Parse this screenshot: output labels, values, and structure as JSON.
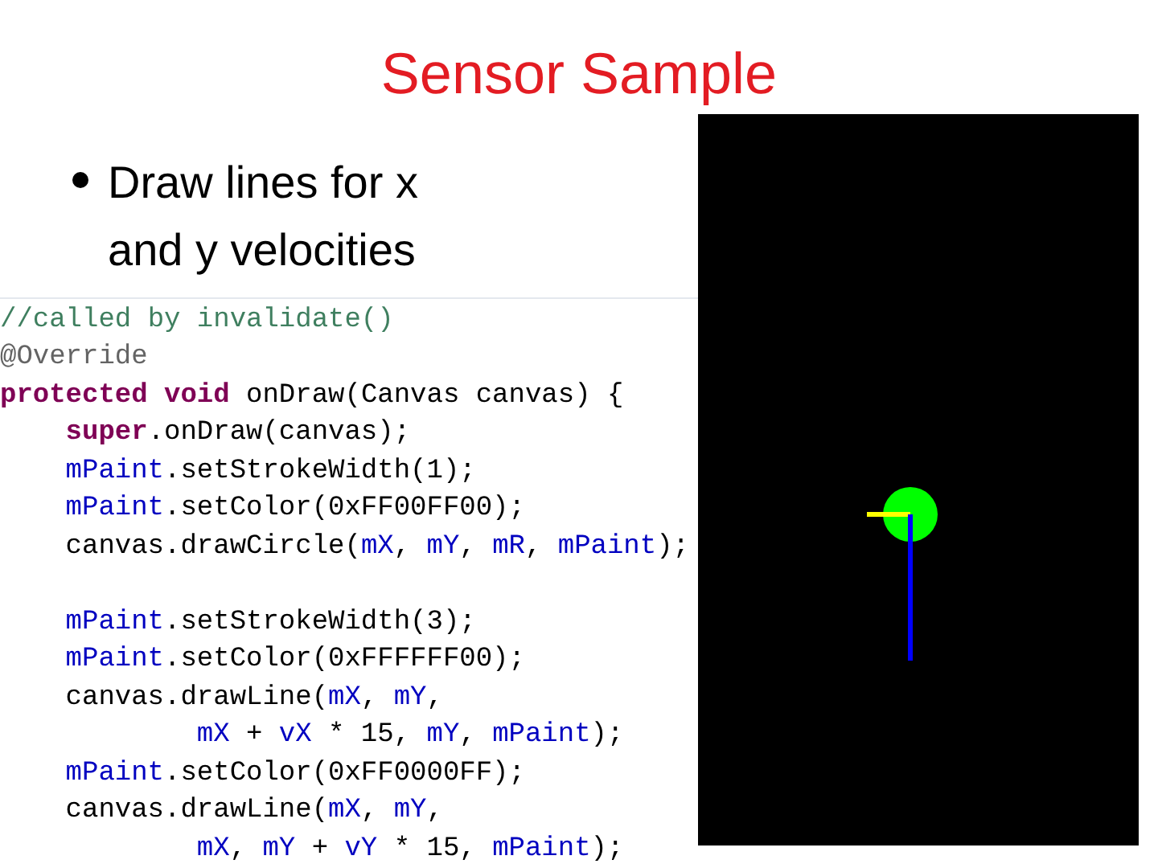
{
  "title": "Sensor Sample",
  "bullets": [
    "Draw lines for x and y velocities"
  ],
  "code": [
    {
      "tokens": [
        {
          "kind": "comment",
          "text": "//called by invalidate()"
        }
      ]
    },
    {
      "tokens": [
        {
          "kind": "annotation",
          "text": "@Override"
        }
      ]
    },
    {
      "tokens": [
        {
          "kind": "keyword",
          "text": "protected void"
        },
        {
          "kind": "plain",
          "text": " onDraw(Canvas canvas) {"
        }
      ],
      "blocks": [
        {
          "lines": [
            {
              "tokens": [
                {
                  "kind": "keyword",
                  "text": "super"
                },
                {
                  "kind": "plain",
                  "text": ".onDraw(canvas);"
                }
              ]
            },
            {
              "tokens": [
                {
                  "kind": "field",
                  "text": "mPaint"
                },
                {
                  "kind": "plain",
                  "text": ".setStrokeWidth(1);"
                }
              ]
            },
            {
              "tokens": [
                {
                  "kind": "field",
                  "text": "mPaint"
                },
                {
                  "kind": "plain",
                  "text": ".setColor(0xFF00FF00);"
                }
              ]
            },
            {
              "tokens": [
                {
                  "kind": "plain",
                  "text": "canvas.drawCircle("
                },
                {
                  "kind": "field",
                  "text": "mX"
                },
                {
                  "kind": "plain",
                  "text": ", "
                },
                {
                  "kind": "field",
                  "text": "mY"
                },
                {
                  "kind": "plain",
                  "text": ", "
                },
                {
                  "kind": "field",
                  "text": "mR"
                },
                {
                  "kind": "plain",
                  "text": ", "
                },
                {
                  "kind": "field",
                  "text": "mPaint"
                },
                {
                  "kind": "plain",
                  "text": ");"
                }
              ]
            }
          ]
        },
        {
          "lines": [
            {
              "tokens": [
                {
                  "kind": "field",
                  "text": "mPaint"
                },
                {
                  "kind": "plain",
                  "text": ".setStrokeWidth(3);"
                }
              ]
            },
            {
              "tokens": [
                {
                  "kind": "field",
                  "text": "mPaint"
                },
                {
                  "kind": "plain",
                  "text": ".setColor(0xFFFFFF00);"
                }
              ]
            },
            {
              "tokens": [
                {
                  "kind": "plain",
                  "text": "canvas.drawLine("
                },
                {
                  "kind": "field",
                  "text": "mX"
                },
                {
                  "kind": "plain",
                  "text": ", "
                },
                {
                  "kind": "field",
                  "text": "mY"
                },
                {
                  "kind": "plain",
                  "text": ","
                }
              ],
              "continuation": [
                {
                  "tokens": [
                    {
                      "kind": "field",
                      "text": "mX"
                    },
                    {
                      "kind": "plain",
                      "text": " + "
                    },
                    {
                      "kind": "field",
                      "text": "vX"
                    },
                    {
                      "kind": "plain",
                      "text": " * 15, "
                    },
                    {
                      "kind": "field",
                      "text": "mY"
                    },
                    {
                      "kind": "plain",
                      "text": ", "
                    },
                    {
                      "kind": "field",
                      "text": "mPaint"
                    },
                    {
                      "kind": "plain",
                      "text": ");"
                    }
                  ]
                }
              ]
            },
            {
              "tokens": [
                {
                  "kind": "field",
                  "text": "mPaint"
                },
                {
                  "kind": "plain",
                  "text": ".setColor(0xFF0000FF);"
                }
              ]
            },
            {
              "tokens": [
                {
                  "kind": "plain",
                  "text": "canvas.drawLine("
                },
                {
                  "kind": "field",
                  "text": "mX"
                },
                {
                  "kind": "plain",
                  "text": ", "
                },
                {
                  "kind": "field",
                  "text": "mY"
                },
                {
                  "kind": "plain",
                  "text": ","
                }
              ],
              "continuation": [
                {
                  "tokens": [
                    {
                      "kind": "field",
                      "text": "mX"
                    },
                    {
                      "kind": "plain",
                      "text": ", "
                    },
                    {
                      "kind": "field",
                      "text": "mY"
                    },
                    {
                      "kind": "plain",
                      "text": " + "
                    },
                    {
                      "kind": "field",
                      "text": "vY"
                    },
                    {
                      "kind": "plain",
                      "text": " * 15, "
                    },
                    {
                      "kind": "field",
                      "text": "mPaint"
                    },
                    {
                      "kind": "plain",
                      "text": ");"
                    }
                  ]
                }
              ]
            }
          ]
        }
      ]
    }
  ]
}
